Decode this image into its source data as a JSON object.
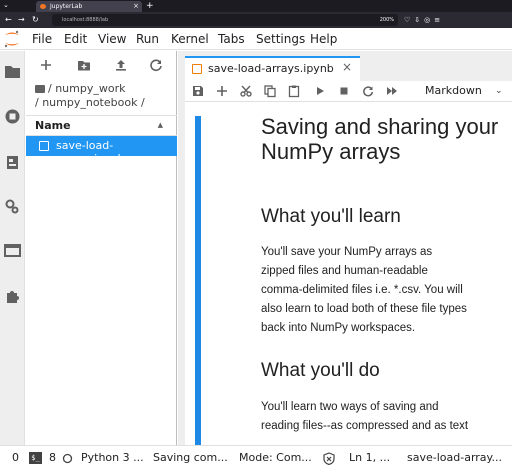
{
  "browser": {
    "tab_title": "JupyterLab",
    "url": "localhost:8888/lab",
    "zoom": "200%"
  },
  "menu": {
    "items": [
      "File",
      "Edit",
      "View",
      "Run",
      "Kernel",
      "Tabs",
      "Settings",
      "Help"
    ]
  },
  "filebrowser": {
    "breadcrumb_line1": "/ numpy_work",
    "breadcrumb_line2": "/ numpy_notebook /",
    "column_header": "Name",
    "sort_indicator": "▲",
    "files": [
      {
        "name": "save-load-arrays.ipynb",
        "selected": true
      }
    ]
  },
  "notebook": {
    "tab_label": "save-load-arrays.ipynb",
    "cell_type": "Markdown",
    "content": {
      "title": "Saving and sharing your NumPy arrays",
      "h_learn": "What you'll learn",
      "p_learn": "You'll save your NumPy arrays as zipped files and human-readable comma-delimited files i.e. *.csv. You will also learn to load both of these file types back into NumPy workspaces.",
      "h_do": "What you'll do",
      "p_do": "You'll learn two ways of saving and reading files--as compressed and as text"
    }
  },
  "statusbar": {
    "mode_count": "0",
    "terminal_label": "$_",
    "terminal_count": "8",
    "kernel": "Python 3 ...",
    "saving": "Saving com...",
    "mode": "Mode: Com...",
    "position": "Ln 1, ...",
    "filename": "save-load-array..."
  },
  "colors": {
    "accent": "#2196f3",
    "cell_bar": "#1e88e5",
    "jupyter_orange": "#f37726"
  }
}
